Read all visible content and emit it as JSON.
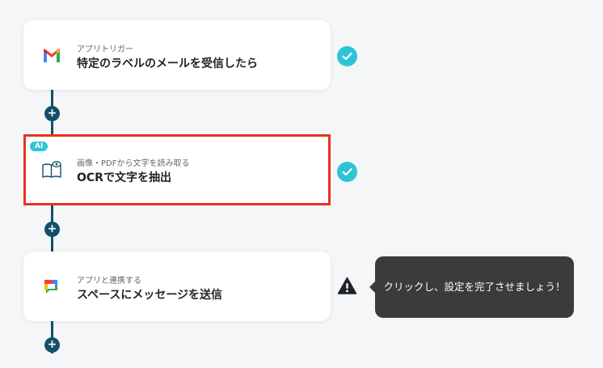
{
  "flow": {
    "steps": [
      {
        "subtitle": "アプリトリガー",
        "title": "特定のラベルのメールを受信したら",
        "icon": "gmail-icon",
        "status": "complete"
      },
      {
        "badge": "AI",
        "subtitle": "画像・PDFから文字を読み取る",
        "title": "OCRで文字を抽出",
        "icon": "ocr-book-icon",
        "status": "complete",
        "selected": true
      },
      {
        "subtitle": "アプリと連携する",
        "title": "スペースにメッセージを送信",
        "icon": "google-chat-icon",
        "status": "warning"
      }
    ],
    "add_step_symbol": "+"
  },
  "tooltip": {
    "text": "クリックし、設定を完了させましょう！"
  },
  "colors": {
    "connector": "#12506a",
    "check": "#2ec4d6",
    "selected_border": "#e8321e",
    "tooltip_bg": "#3a3b3d"
  }
}
